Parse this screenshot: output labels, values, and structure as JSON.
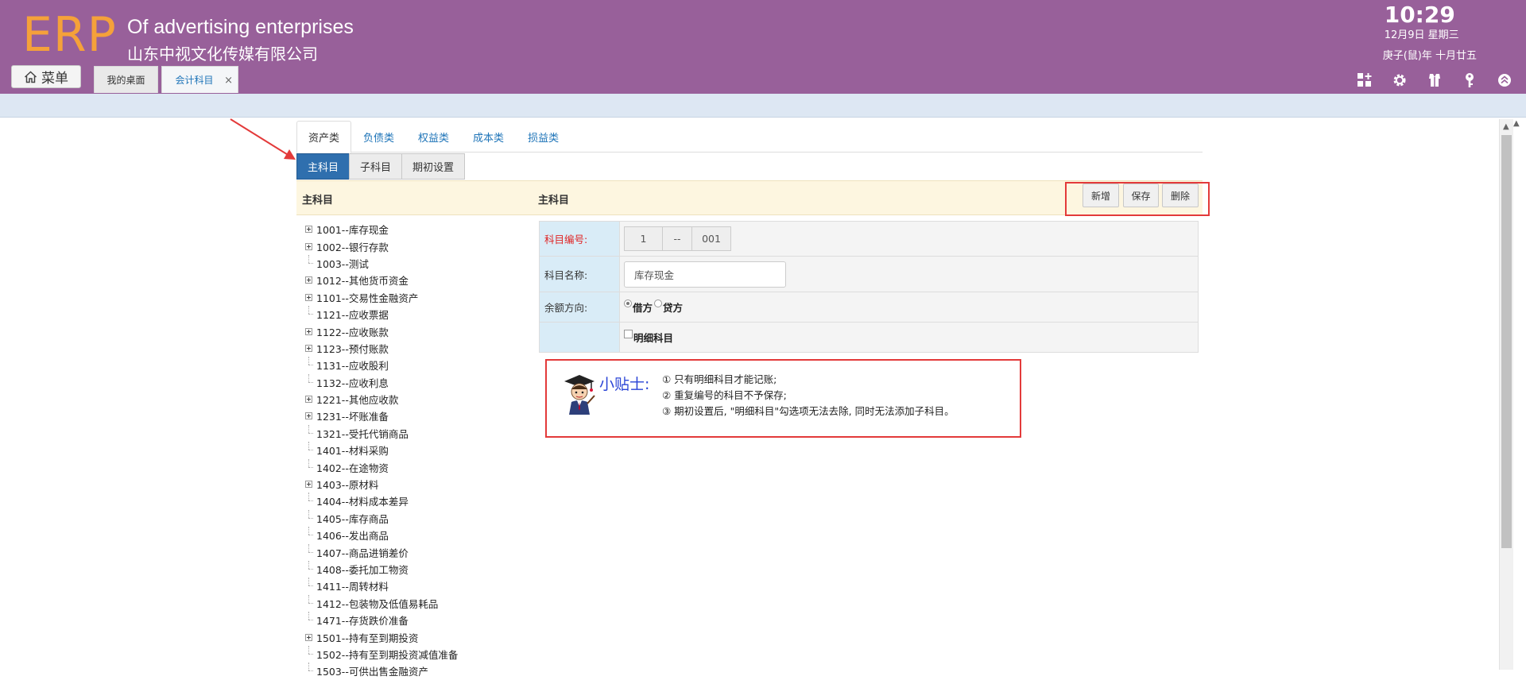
{
  "header": {
    "logo": "ERP",
    "company_en": "Of advertising enterprises",
    "company_cn": "山东中视文化传媒有限公司",
    "time": "10:29",
    "date": "12月9日 星期三",
    "lunar": "庚子(鼠)年 十月廿五",
    "menu_label": "菜单",
    "tabs": [
      {
        "label": "我的桌面"
      },
      {
        "label": "会计科目",
        "close": "×"
      }
    ],
    "icons": [
      "apps-icon",
      "gear-icon",
      "shirt-icon",
      "key-icon",
      "collapse-up-icon"
    ]
  },
  "category_tabs": [
    "资产类",
    "负债类",
    "权益类",
    "成本类",
    "损益类"
  ],
  "sub_tabs": [
    "主科目",
    "子科目",
    "期初设置"
  ],
  "section": {
    "left_title": "主科目",
    "right_title": "主科目",
    "buttons": {
      "add": "新增",
      "save": "保存",
      "delete": "删除"
    }
  },
  "tree": [
    {
      "code": "1001--库存现金",
      "expandable": true
    },
    {
      "code": "1002--银行存款",
      "expandable": true
    },
    {
      "code": "1003--测试",
      "expandable": false
    },
    {
      "code": "1012--其他货币资金",
      "expandable": true
    },
    {
      "code": "1101--交易性金融资产",
      "expandable": true
    },
    {
      "code": "1121--应收票据",
      "expandable": false
    },
    {
      "code": "1122--应收账款",
      "expandable": true
    },
    {
      "code": "1123--预付账款",
      "expandable": true
    },
    {
      "code": "1131--应收股利",
      "expandable": false
    },
    {
      "code": "1132--应收利息",
      "expandable": false
    },
    {
      "code": "1221--其他应收款",
      "expandable": true
    },
    {
      "code": "1231--坏账准备",
      "expandable": true
    },
    {
      "code": "1321--受托代销商品",
      "expandable": false
    },
    {
      "code": "1401--材料采购",
      "expandable": false
    },
    {
      "code": "1402--在途物资",
      "expandable": false
    },
    {
      "code": "1403--原材料",
      "expandable": true
    },
    {
      "code": "1404--材料成本差异",
      "expandable": false
    },
    {
      "code": "1405--库存商品",
      "expandable": false
    },
    {
      "code": "1406--发出商品",
      "expandable": false
    },
    {
      "code": "1407--商品进销差价",
      "expandable": false
    },
    {
      "code": "1408--委托加工物资",
      "expandable": false
    },
    {
      "code": "1411--周转材料",
      "expandable": false
    },
    {
      "code": "1412--包装物及低值易耗品",
      "expandable": false
    },
    {
      "code": "1471--存货跌价准备",
      "expandable": false
    },
    {
      "code": "1501--持有至到期投资",
      "expandable": true
    },
    {
      "code": "1502--持有至到期投资减值准备",
      "expandable": false
    },
    {
      "code": "1503--可供出售金融资产",
      "expandable": false
    }
  ],
  "form": {
    "code_label": "科目编号:",
    "code_parts": [
      "1",
      "--",
      "001"
    ],
    "name_label": "科目名称:",
    "name_value": "库存现金",
    "balance_label": "余额方向:",
    "debit": "借方",
    "credit": "贷方",
    "detail_label": "明细科目"
  },
  "tips": {
    "title": "小贴士:",
    "items": [
      "① 只有明细科目才能记账;",
      "② 重复编号的科目不予保存;",
      "③ 期初设置后, \"明细科目\"勾选项无法去除, 同时无法添加子科目。"
    ]
  },
  "colors": {
    "header": "#98609a",
    "logo": "#f5a13a",
    "active_subtab": "#2f6fae",
    "highlight_box": "#e33a3a",
    "section_bg": "#fdf6e0"
  }
}
